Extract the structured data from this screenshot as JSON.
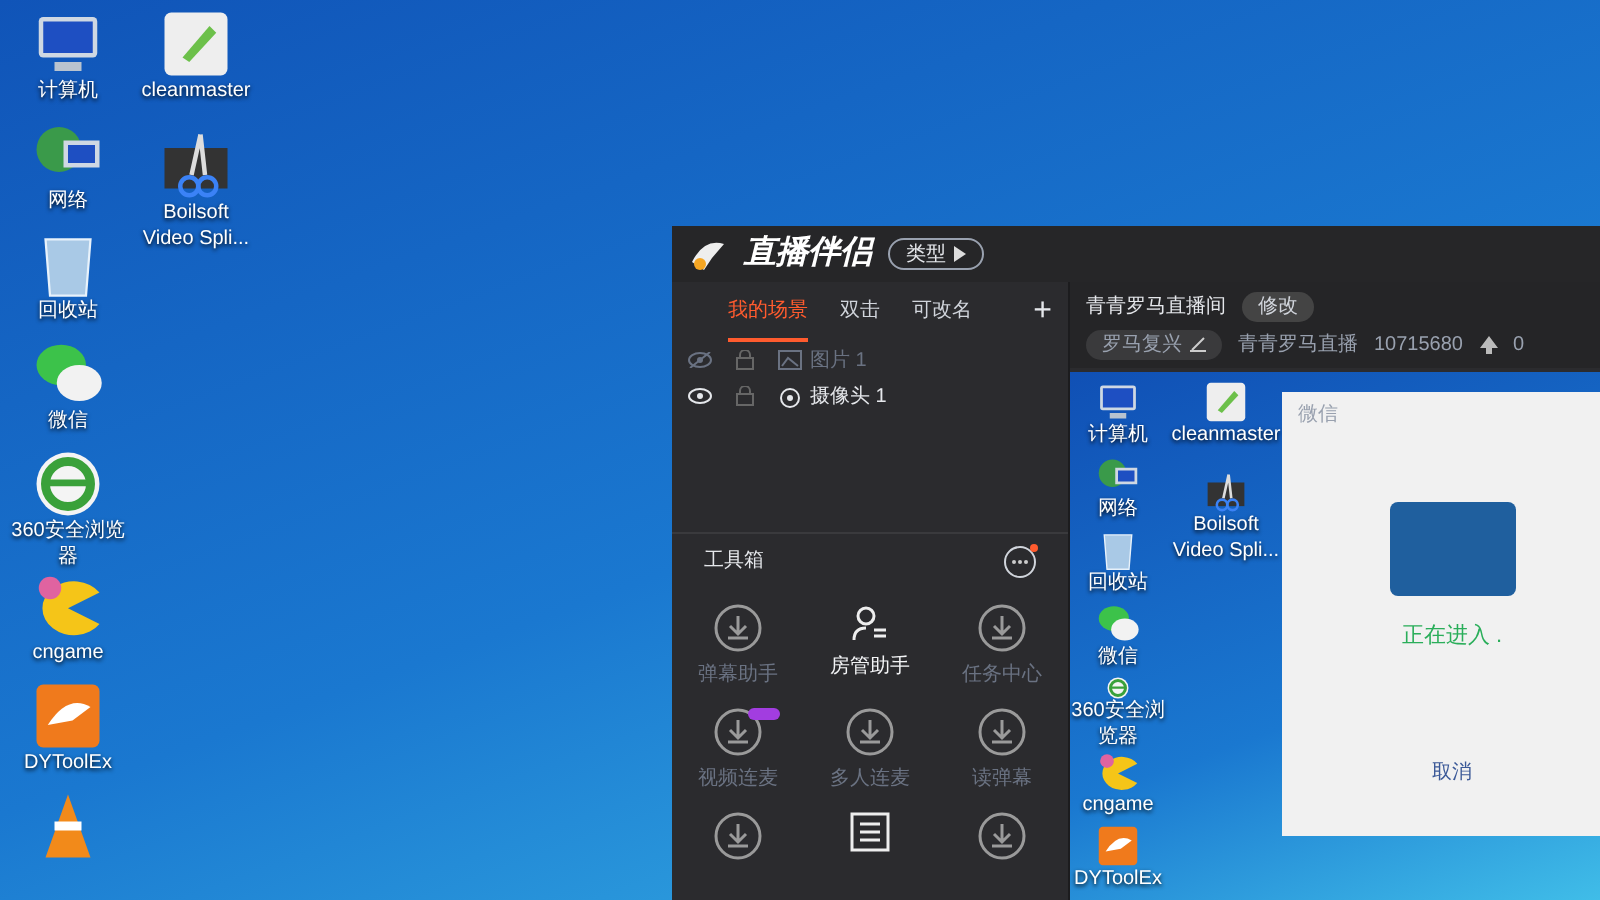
{
  "desktop": {
    "columns": [
      [
        {
          "kind": "computer",
          "label": "计算机"
        },
        {
          "kind": "network",
          "label": "网络"
        },
        {
          "kind": "recycle",
          "label": "回收站"
        },
        {
          "kind": "chat",
          "label": "微信"
        },
        {
          "kind": "browser",
          "label": "360安全浏览器"
        },
        {
          "kind": "game",
          "label": "cngame"
        },
        {
          "kind": "tool",
          "label": "DYToolEx"
        },
        {
          "kind": "cone"
        }
      ],
      [
        {
          "kind": "cleaner",
          "label": "cleanmaster"
        },
        {
          "kind": "scissors",
          "label": "Boilsoft Video Spli..."
        }
      ]
    ]
  },
  "app": {
    "title": "直播伴侣",
    "type_button": "类型",
    "scene_tabs": [
      {
        "label": "我的场景",
        "selected": true
      },
      {
        "label": "双击",
        "selected": false
      },
      {
        "label": "可改名",
        "selected": false
      }
    ],
    "add_label": "+",
    "sources": [
      {
        "label": "图片 1",
        "visible": false,
        "kind": "image"
      },
      {
        "label": "摄像头 1",
        "visible": true,
        "kind": "camera"
      }
    ],
    "toolbox": {
      "title": "工具箱",
      "tools": [
        {
          "label": "弹幕助手",
          "installed": false
        },
        {
          "label": "房管助手",
          "installed": true
        },
        {
          "label": "任务中心",
          "installed": false
        },
        {
          "label": "视频连麦",
          "installed": false,
          "badge": true
        },
        {
          "label": "多人连麦",
          "installed": false
        },
        {
          "label": "读弹幕",
          "installed": false
        },
        {
          "installed": false
        },
        {
          "installed": true
        },
        {
          "installed": false
        }
      ]
    },
    "room": {
      "name": "青青罗马直播间",
      "edit_button": "修改",
      "category": "罗马复兴",
      "streamer": "青青罗马直播",
      "id": "10715680",
      "popularity": "0"
    },
    "preview": {
      "icons": [
        {
          "kind": "computer",
          "label": "计算机"
        },
        {
          "kind": "network",
          "label": "网络"
        },
        {
          "kind": "recycle",
          "label": "回收站"
        },
        {
          "kind": "chat",
          "label": "微信"
        },
        {
          "kind": "browser",
          "label": "360安全浏览器"
        },
        {
          "kind": "game",
          "label": "cngame"
        },
        {
          "kind": "tool",
          "label": "DYToolEx"
        }
      ],
      "icons2": [
        {
          "kind": "cleaner",
          "label": "cleanmaster"
        },
        {
          "kind": "scissors",
          "label": "Boilsoft Video Spli..."
        }
      ],
      "dialog": {
        "title": "微信",
        "status": "正在进入 .",
        "cancel": "取消"
      }
    }
  }
}
